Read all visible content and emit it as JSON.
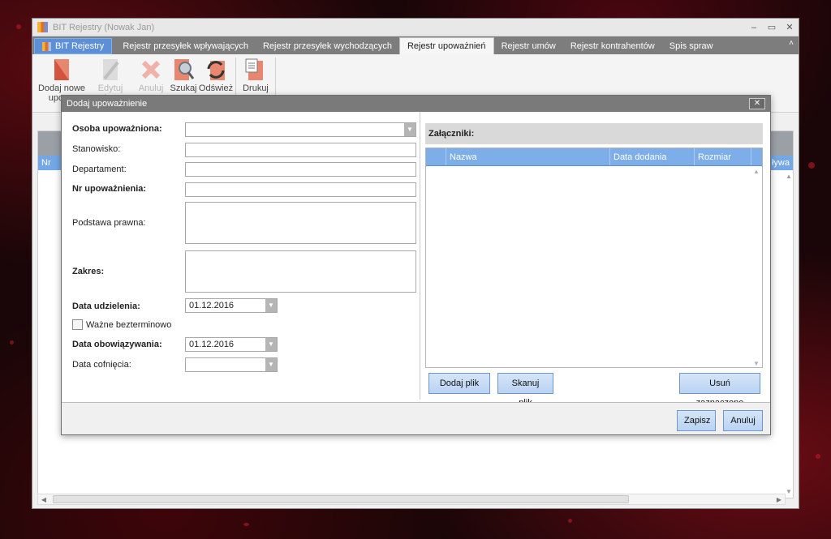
{
  "window": {
    "title": "BIT Rejestry (Nowak Jan)",
    "min_glyph": "–",
    "max_glyph": "▭",
    "close_glyph": "✕"
  },
  "tabs": [
    {
      "label": "BIT Rejestry"
    },
    {
      "label": "Rejestr przesyłek wpływających"
    },
    {
      "label": "Rejestr przesyłek wychodzących"
    },
    {
      "label": "Rejestr upoważnień"
    },
    {
      "label": "Rejestr umów"
    },
    {
      "label": "Rejestr kontrahentów"
    },
    {
      "label": "Spis spraw"
    }
  ],
  "tabs_collapse_glyph": "˄",
  "ribbon": {
    "add": "Dodaj nowe upowa",
    "edit": "Edytuj wybrane",
    "cancel": "Anuluj",
    "search": "Szukaj",
    "refresh": "Odśwież",
    "print": "Drukuj"
  },
  "underlying_list": {
    "col_first": "Nr",
    "col_last": "ływa"
  },
  "dialog": {
    "title": "Dodaj upoważnienie",
    "close_glyph": "✕",
    "fields": {
      "person_label": "Osoba upoważniona:",
      "person_value": "",
      "position_label": "Stanowisko:",
      "position_value": "",
      "department_label": "Departament:",
      "department_value": "",
      "number_label": "Nr upoważnienia:",
      "number_value": "",
      "legal_basis_label": "Podstawa prawna:",
      "legal_basis_value": "",
      "scope_label": "Zakres:",
      "scope_value": "",
      "grant_date_label": "Data udzielenia:",
      "grant_date_value": "01.12.2016",
      "indefinite_label": "Ważne bezterminowo",
      "valid_date_label": "Data obowiązywania:",
      "valid_date_value": "01.12.2016",
      "revoke_date_label": "Data cofnięcia:",
      "revoke_date_value": ""
    },
    "attachments": {
      "header": "Załączniki:",
      "columns": [
        "Nazwa",
        "Data dodania",
        "Rozmiar"
      ],
      "add_file": "Dodaj plik ...",
      "scan_file": "Skanuj plik",
      "remove_selected": "Usuń zaznaczone"
    },
    "save": "Zapisz",
    "cancel": "Anuluj"
  },
  "colors": {
    "accent_blue": "#7eaee9",
    "button_blue": "#c8ddf5",
    "dialog_title": "#7a7a7a",
    "tab_strip": "#7d7d7d"
  }
}
